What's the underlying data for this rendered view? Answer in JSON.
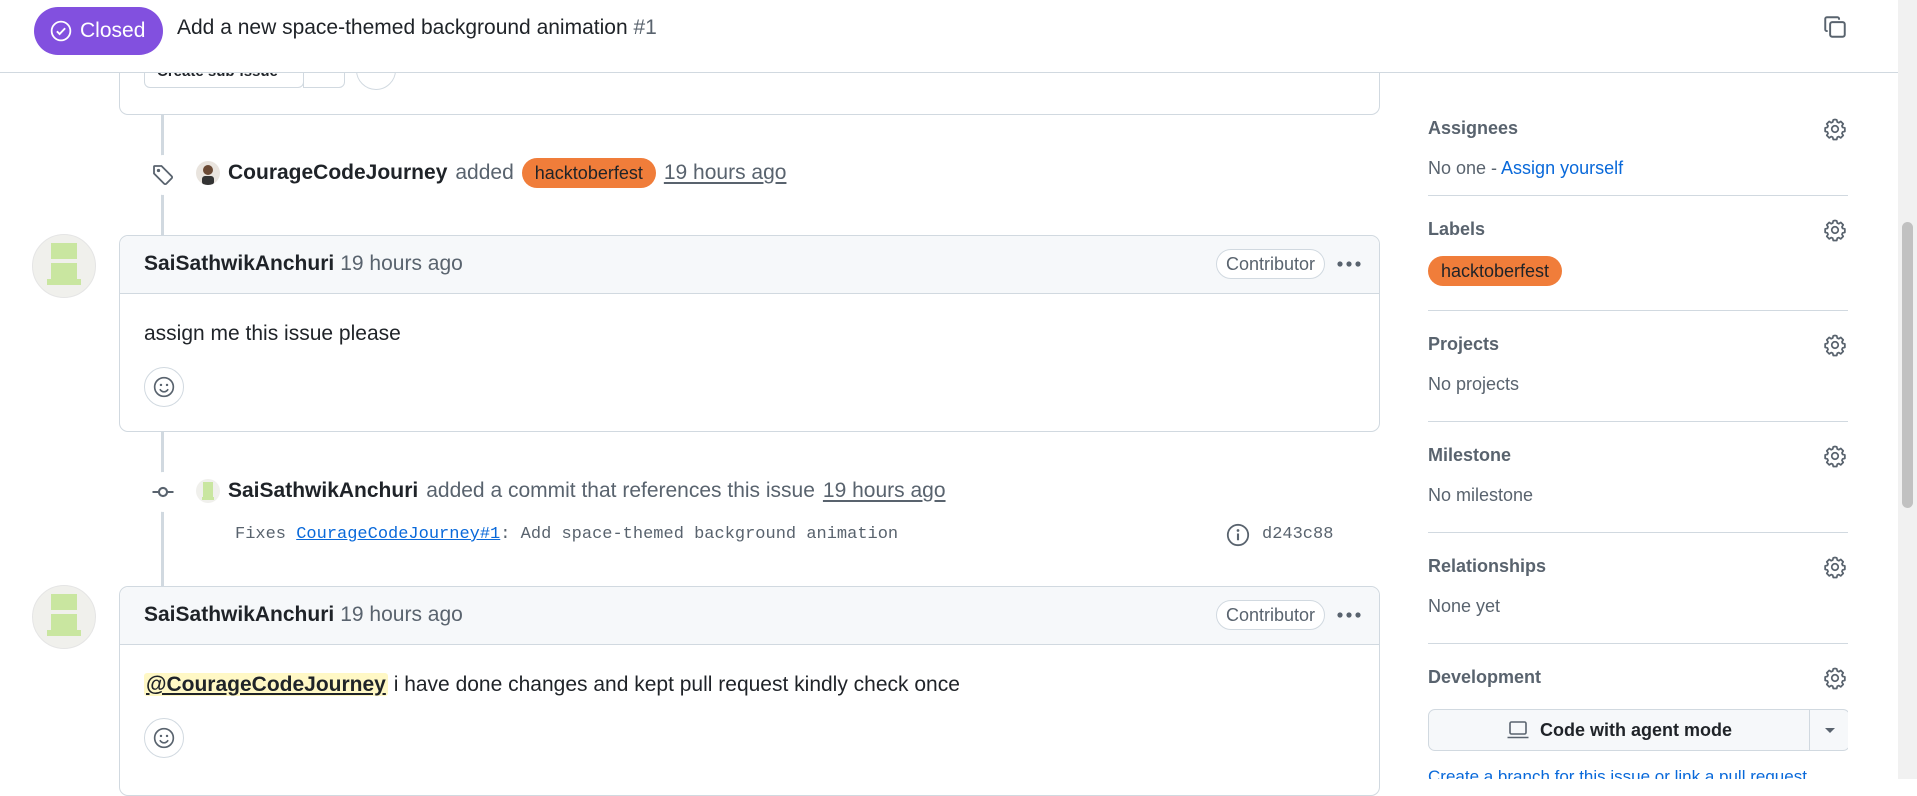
{
  "colors": {
    "closed": "#8250df",
    "label": "#f07d3a",
    "link": "#0969da"
  },
  "header": {
    "state": "Closed",
    "title": "Add a new space-themed background animation",
    "number": "#1"
  },
  "partial_card": {
    "button_label": "Create sub-issue"
  },
  "label_event": {
    "actor": "CourageCodeJourney",
    "action": "added",
    "label": "hacktoberfest",
    "time": "19 hours ago"
  },
  "comment1": {
    "author": "SaiSathwikAnchuri",
    "time": "19 hours ago",
    "role": "Contributor",
    "body": "assign me this issue please"
  },
  "commit_event": {
    "actor": "SaiSathwikAnchuri",
    "action": "added a commit that references this issue",
    "time": "19 hours ago",
    "message_prefix": "Fixes",
    "message_link": "CourageCodeJourney#1",
    "message_suffix": ": Add space-themed background animation",
    "sha": "d243c88"
  },
  "comment2": {
    "author": "SaiSathwikAnchuri",
    "time": "19 hours ago",
    "role": "Contributor",
    "mention": "@CourageCodeJourney",
    "body": " i have done changes and kept pull request kindly check once"
  },
  "sidebar": {
    "assignees": {
      "title": "Assignees",
      "value": "No one - ",
      "link": "Assign yourself"
    },
    "labels": {
      "title": "Labels",
      "label": "hacktoberfest"
    },
    "projects": {
      "title": "Projects",
      "value": "No projects"
    },
    "milestone": {
      "title": "Milestone",
      "value": "No milestone"
    },
    "relationships": {
      "title": "Relationships",
      "value": "None yet"
    },
    "development": {
      "title": "Development",
      "button": "Code with agent mode",
      "footer": "Create a branch for this issue or link a pull request."
    }
  }
}
